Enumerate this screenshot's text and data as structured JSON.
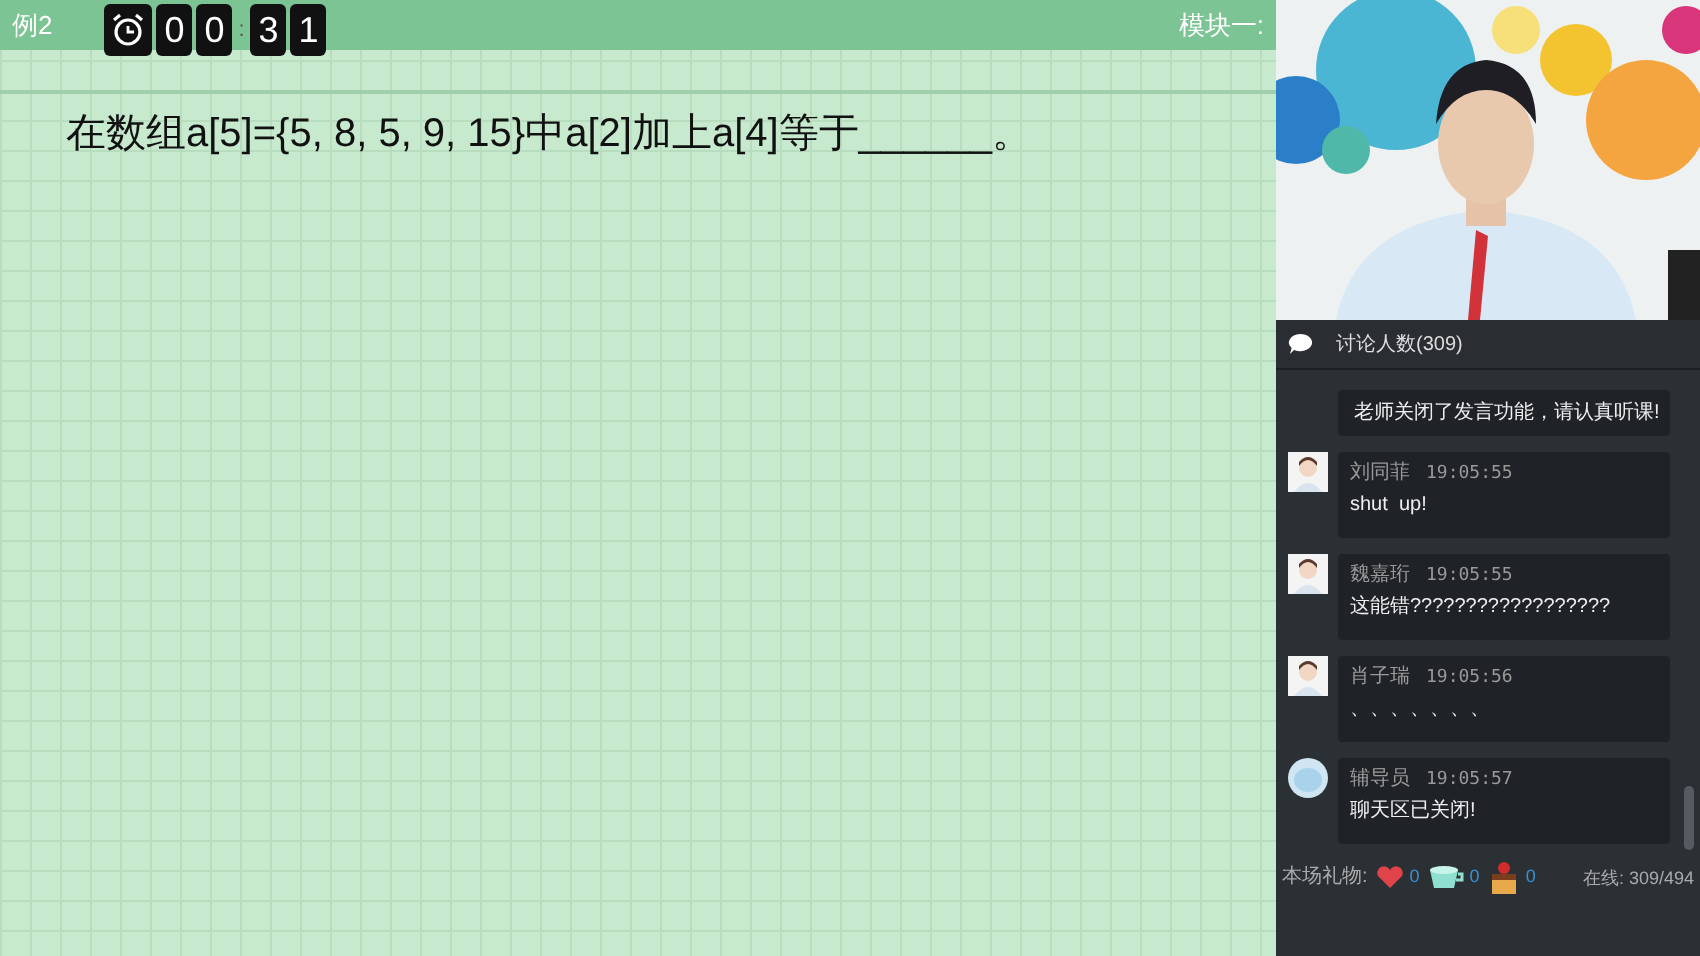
{
  "lesson": {
    "label": "例2",
    "timer_digits": [
      "0",
      "0",
      "3",
      "1"
    ],
    "timer_separator": ":",
    "module": "模块一:"
  },
  "question": "在数组a[5]={5, 8, 5, 9, 15}中a[2]加上a[4]等于______。",
  "chat": {
    "title": "讨论人数(309)",
    "messages": [
      {
        "kind": "system",
        "text": "老师关闭了发言功能，请认真听课!"
      },
      {
        "kind": "student",
        "name": "刘同菲",
        "time": "19:05:55",
        "text": "shut  up!"
      },
      {
        "kind": "student",
        "name": "魏嘉珩",
        "time": "19:05:55",
        "text": "这能错??????????????????"
      },
      {
        "kind": "student",
        "name": "肖子瑞",
        "time": "19:05:56",
        "text": "、、、、、、、"
      },
      {
        "kind": "tutor",
        "name": "辅导员",
        "time": "19:05:57",
        "text": "聊天区已关闭!"
      }
    ]
  },
  "gifts": {
    "label": "本场礼物:",
    "items": [
      {
        "kind": "heart",
        "count": "0"
      },
      {
        "kind": "cup",
        "count": "0"
      },
      {
        "kind": "cake",
        "count": "0"
      }
    ]
  },
  "online": "在线: 309/494"
}
